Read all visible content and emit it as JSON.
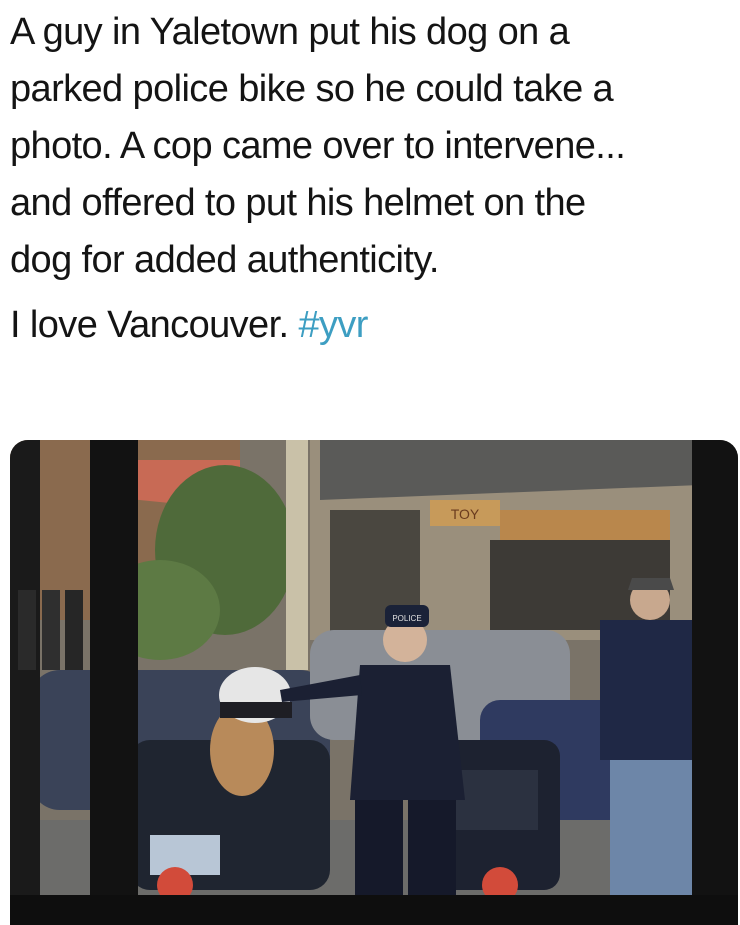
{
  "tweet": {
    "lines": [
      "A guy in Yaletown put his dog on a",
      "parked police bike so he could take a",
      "photo. A cop came over to intervene...",
      "and offered to put his helmet on the",
      "dog for added authenticity."
    ],
    "closing_text": "I love Vancouver. ",
    "hashtag": "#yvr",
    "hashtag_color": "#3d9ec2"
  },
  "photo": {
    "helmet_label": "POLICE",
    "shop_sign": "TOY"
  }
}
